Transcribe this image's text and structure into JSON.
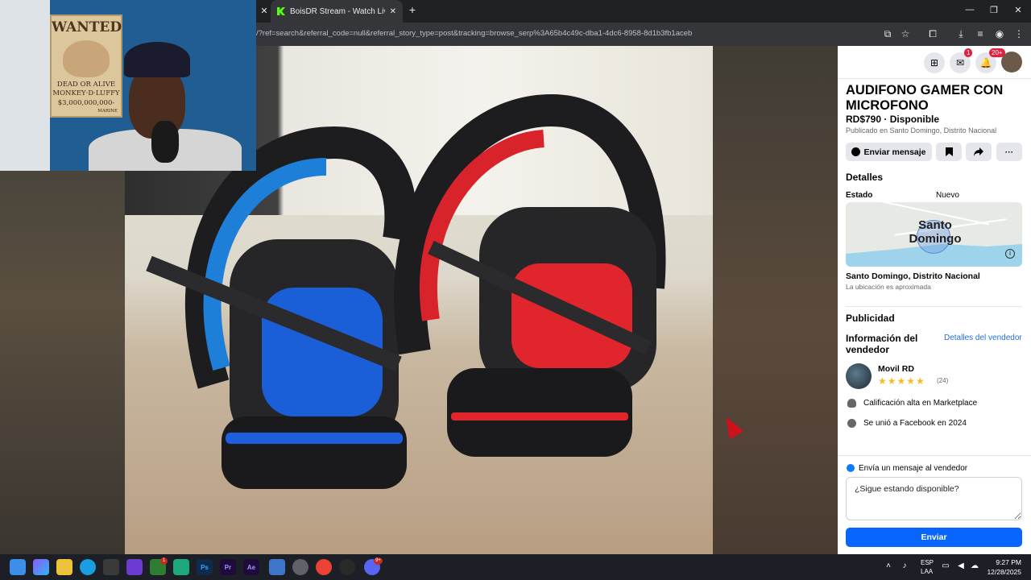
{
  "browser": {
    "active_tab_title": "BoisDR Stream - Watch Live on",
    "url": "/?ref=search&referral_code=null&referral_story_type=post&tracking=browse_serp%3A65b4c49c-dba1-4dc6-8958-8d1b3fb1aceb",
    "new_tab_label": "+",
    "close_tab_label": "✕",
    "prev_tab_close_label": "✕"
  },
  "webcam_poster": {
    "title": "WANTED",
    "line1": "DEAD OR ALIVE",
    "line2": "MONKEY·D·LUFFY",
    "line3": "$3,000,000,000-",
    "line4": "MARINE"
  },
  "facebook": {
    "top_icons": {
      "menu": "⊞",
      "messenger": "✉",
      "messenger_badge": "1",
      "notifications": "🔔",
      "notifications_badge": "20+"
    },
    "listing": {
      "title": "AUDIFONO GAMER CON MICROFONO",
      "price_line": "RD$790 · Disponible",
      "published": "Publicado en Santo Domingo, Distrito Nacional",
      "message_button": "Enviar mensaje",
      "more_button": "···"
    },
    "details": {
      "heading": "Detalles",
      "condition_label": "Estado",
      "condition_value": "Nuevo",
      "map_label": "Santo Domingo",
      "location_name": "Santo Domingo, Distrito Nacional",
      "location_note": "La ubicación es aproximada"
    },
    "ads_heading": "Publicidad",
    "seller": {
      "heading": "Información del vendedor",
      "details_link": "Detalles del vendedor",
      "name": "Movil RD",
      "stars": "★★★★★",
      "rating_count": "(24)",
      "feature1": "Calificación alta en Marketplace",
      "feature2": "Se unió a Facebook en 2024"
    },
    "message_box": {
      "heading": "Envía un mensaje al vendedor",
      "input_value": "¿Sigue estando disponible?",
      "send_button": "Enviar"
    }
  },
  "taskbar": {
    "lang1": "ESP",
    "lang2": "LAA",
    "time": "9:27 PM",
    "date": "12/28/2025",
    "xbox_badge": "1",
    "discord_badge": "9+"
  },
  "colors": {
    "fb_blue": "#0866ff",
    "link_blue": "#216fdb",
    "star_yellow": "#f7b928",
    "badge_red": "#e41e3f"
  }
}
